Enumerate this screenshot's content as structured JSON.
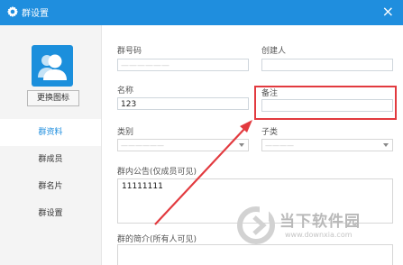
{
  "window": {
    "title": "群设置",
    "close": "×"
  },
  "sidebar": {
    "change_icon_label": "更换图标",
    "items": [
      {
        "label": "群资料"
      },
      {
        "label": "群成员"
      },
      {
        "label": "群名片"
      },
      {
        "label": "群设置"
      }
    ]
  },
  "form": {
    "group_id": {
      "label": "群号码",
      "value": "——————"
    },
    "creator": {
      "label": "创建人",
      "value": ""
    },
    "name": {
      "label": "名称",
      "value": "123"
    },
    "remark": {
      "label": "备注",
      "value": ""
    },
    "category": {
      "label": "类别",
      "value": "——————"
    },
    "subcategory": {
      "label": "子类",
      "value": "————"
    },
    "announcement": {
      "label": "群内公告(仅成员可见)",
      "value": "11111111"
    },
    "intro": {
      "label": "群的简介(所有人可见)",
      "value": ""
    }
  },
  "watermark": {
    "title": "当下软件园",
    "url": "www.downxia.com"
  },
  "colors": {
    "title_bar": "#1f8ede",
    "accent": "#1f8ede",
    "annotation": "#e23a3f"
  }
}
